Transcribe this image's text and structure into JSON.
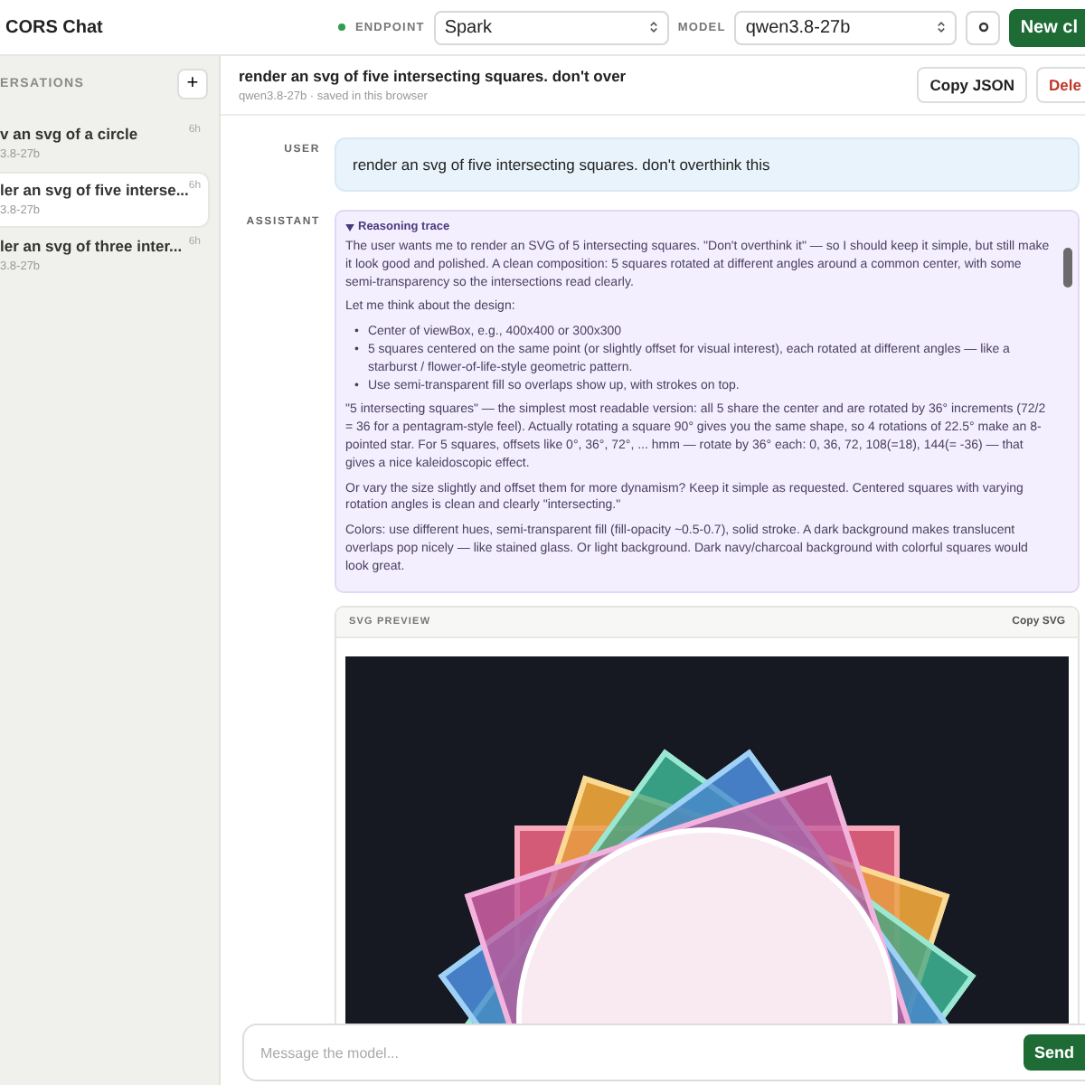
{
  "app": {
    "title": "CORS Chat"
  },
  "endpoint": {
    "label": "ENDPOINT",
    "value": "Spark"
  },
  "model": {
    "label": "MODEL",
    "value": "qwen3.8-27b"
  },
  "new_chat_button": "New cl",
  "sidebar": {
    "heading": "ERSATIONS",
    "add_button": "+",
    "items": [
      {
        "title": "v an svg of a circle",
        "subtitle": "3.8-27b",
        "time": "6h",
        "selected": false
      },
      {
        "title": "ler an svg of five interse...",
        "subtitle": "3.8-27b",
        "time": "6h",
        "selected": true
      },
      {
        "title": "ler an svg of three inter...",
        "subtitle": "3.8-27b",
        "time": "6h",
        "selected": false
      }
    ]
  },
  "conversation": {
    "title": "render an svg of five intersecting squares. don't over",
    "meta": "qwen3.8-27b · saved in this browser",
    "copy_button": "Copy JSON",
    "delete_button": "Dele"
  },
  "messages": [
    {
      "role": "USER",
      "kind": "user",
      "text": "render an svg of five intersecting squares. don't overthink this"
    },
    {
      "role": "ASSISTANT",
      "kind": "assistant",
      "reasoning": {
        "title": "Reasoning trace",
        "expanded": true,
        "blocks": [
          {
            "kind": "p",
            "text": "The user wants me to render an SVG of 5 intersecting squares. \"Don't overthink it\" — so I should keep it simple, but still make it look good and polished. A clean composition: 5 squares rotated at different angles around a common center, with some semi-transparency so the intersections read clearly."
          },
          {
            "kind": "p",
            "text": "Let me think about the design:"
          },
          {
            "kind": "list",
            "marker": "•",
            "items": [
              "Center of viewBox, e.g., 400x400 or 300x300",
              "5 squares centered on the same point (or slightly offset for visual interest), each rotated at different angles — like a starburst / flower-of-life-style geometric pattern.",
              "Use semi-transparent fill so overlaps show up, with strokes on top."
            ]
          },
          {
            "kind": "p",
            "text": "\"5 intersecting squares\" — the simplest most readable version: all 5 share the center and are rotated by 36° increments (72/2 = 36 for a pentagram-style feel). Actually rotating a square 90° gives you the same shape, so 4 rotations of 22.5° make an 8-pointed star. For 5 squares, offsets like 0°, 36°, 72°, ... hmm — rotate by 36° each: 0, 36, 72, 108(=18), 144(= -36) — that gives a nice kaleidoscopic effect."
          },
          {
            "kind": "p",
            "text": "Or vary the size slightly and offset them for more dynamism? Keep it simple as requested. Centered squares with varying rotation angles is clean and clearly \"intersecting.\""
          },
          {
            "kind": "p",
            "text": "Colors: use different hues, semi-transparent fill (fill-opacity ~0.5-0.7), solid stroke. A dark background makes translucent overlaps pop nicely — like stained glass. Or light background. Dark navy/charcoal background with colorful squares would look great."
          }
        ]
      },
      "preview": {
        "title": "SVG PREVIEW",
        "copy_button": "Copy SVG"
      }
    }
  ],
  "composer": {
    "placeholder": "Message the model...",
    "send_button": "Send"
  }
}
